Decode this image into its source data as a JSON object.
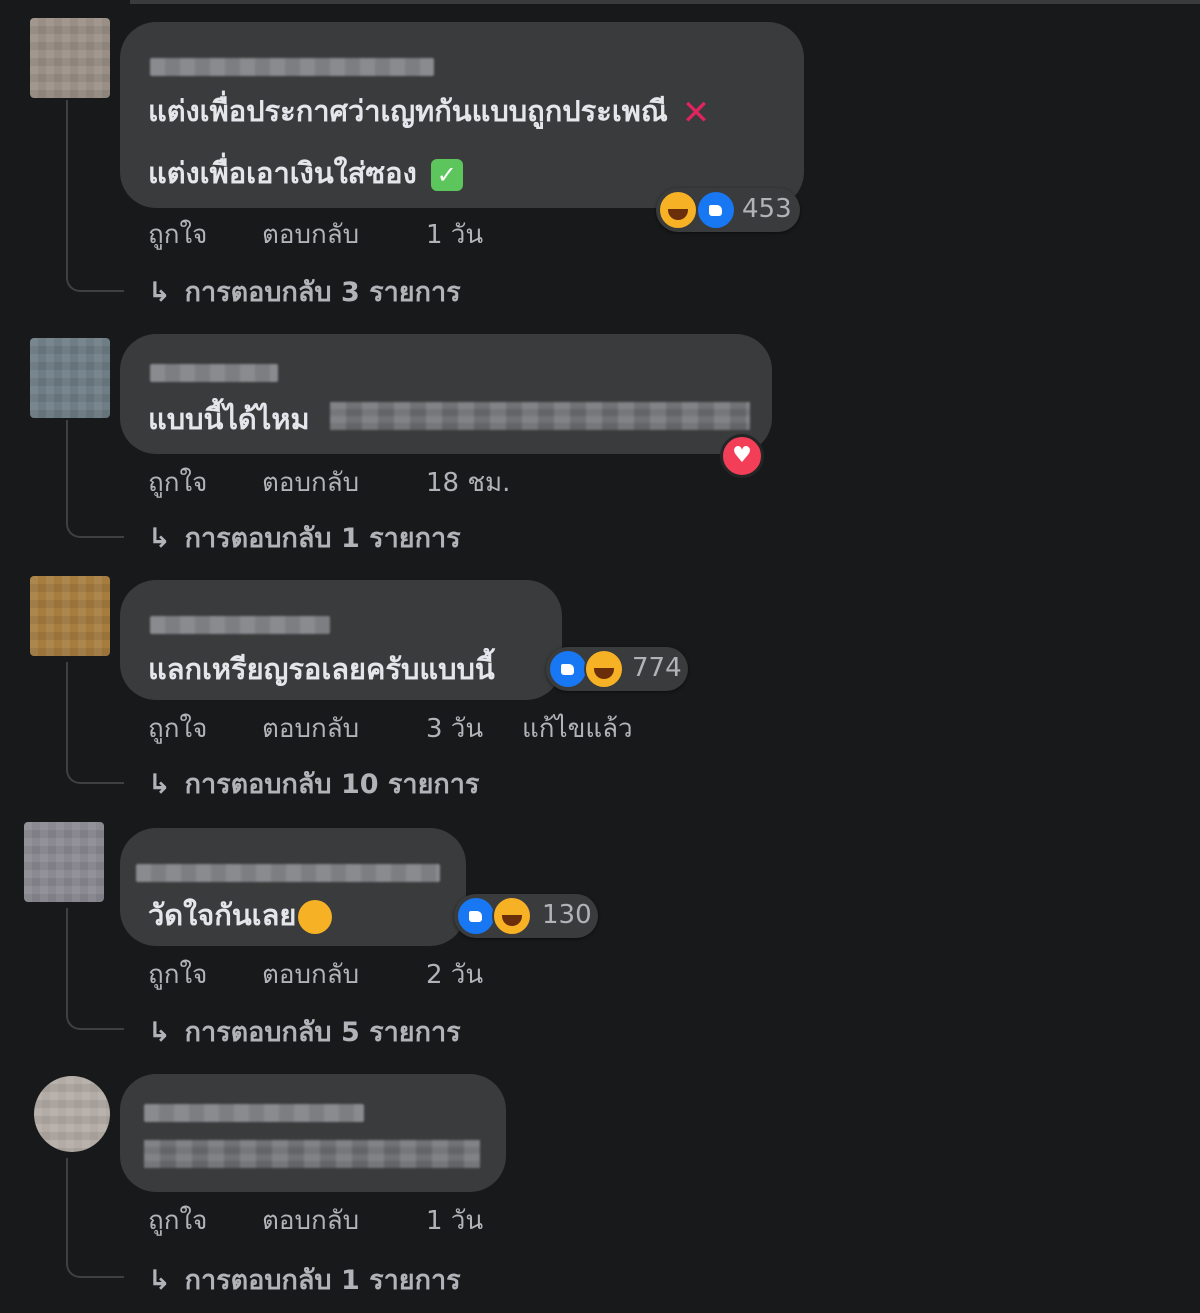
{
  "labels": {
    "like": "ถูกใจ",
    "reply": "ตอบกลับ"
  },
  "comments": [
    {
      "lines": [
        "แต่งเพื่อประกาศว่าเญทกันแบบถูกประเพณี",
        "แต่งเพื่อเอาเงินใส่ซอง"
      ],
      "reaction_count": "453",
      "time": "1 วัน",
      "replies": "การตอบกลับ 3 รายการ"
    },
    {
      "lines": [
        "แบบนี้ได้ไหม"
      ],
      "time": "18 ชม.",
      "replies": "การตอบกลับ 1 รายการ"
    },
    {
      "lines": [
        "แลกเหรียญรอเลยครับแบบนี้"
      ],
      "reaction_count": "774",
      "time": "3 วัน",
      "edited": "แก้ไขแล้ว",
      "replies": "การตอบกลับ 10 รายการ"
    },
    {
      "lines": [
        "วัดใจกันเลย"
      ],
      "reaction_count": "130",
      "time": "2 วัน",
      "replies": "การตอบกลับ 5 รายการ"
    },
    {
      "lines": [],
      "time": "1 วัน",
      "replies": "การตอบกลับ 1 รายการ"
    }
  ],
  "icons": {
    "x_mark": "cross-mark-icon",
    "check": "check-mark-icon",
    "like": "like-reaction-icon",
    "haha": "haha-reaction-icon",
    "love": "love-reaction-icon",
    "reply_arrow": "reply-arrow-icon"
  },
  "colors": {
    "background": "#18191a",
    "bubble": "#3a3b3c",
    "text": "#e4e6eb",
    "secondary_text": "#b0b3b8",
    "like_blue": "#1877f2",
    "haha_yellow": "#f7b125",
    "love_red": "#f33e58"
  }
}
